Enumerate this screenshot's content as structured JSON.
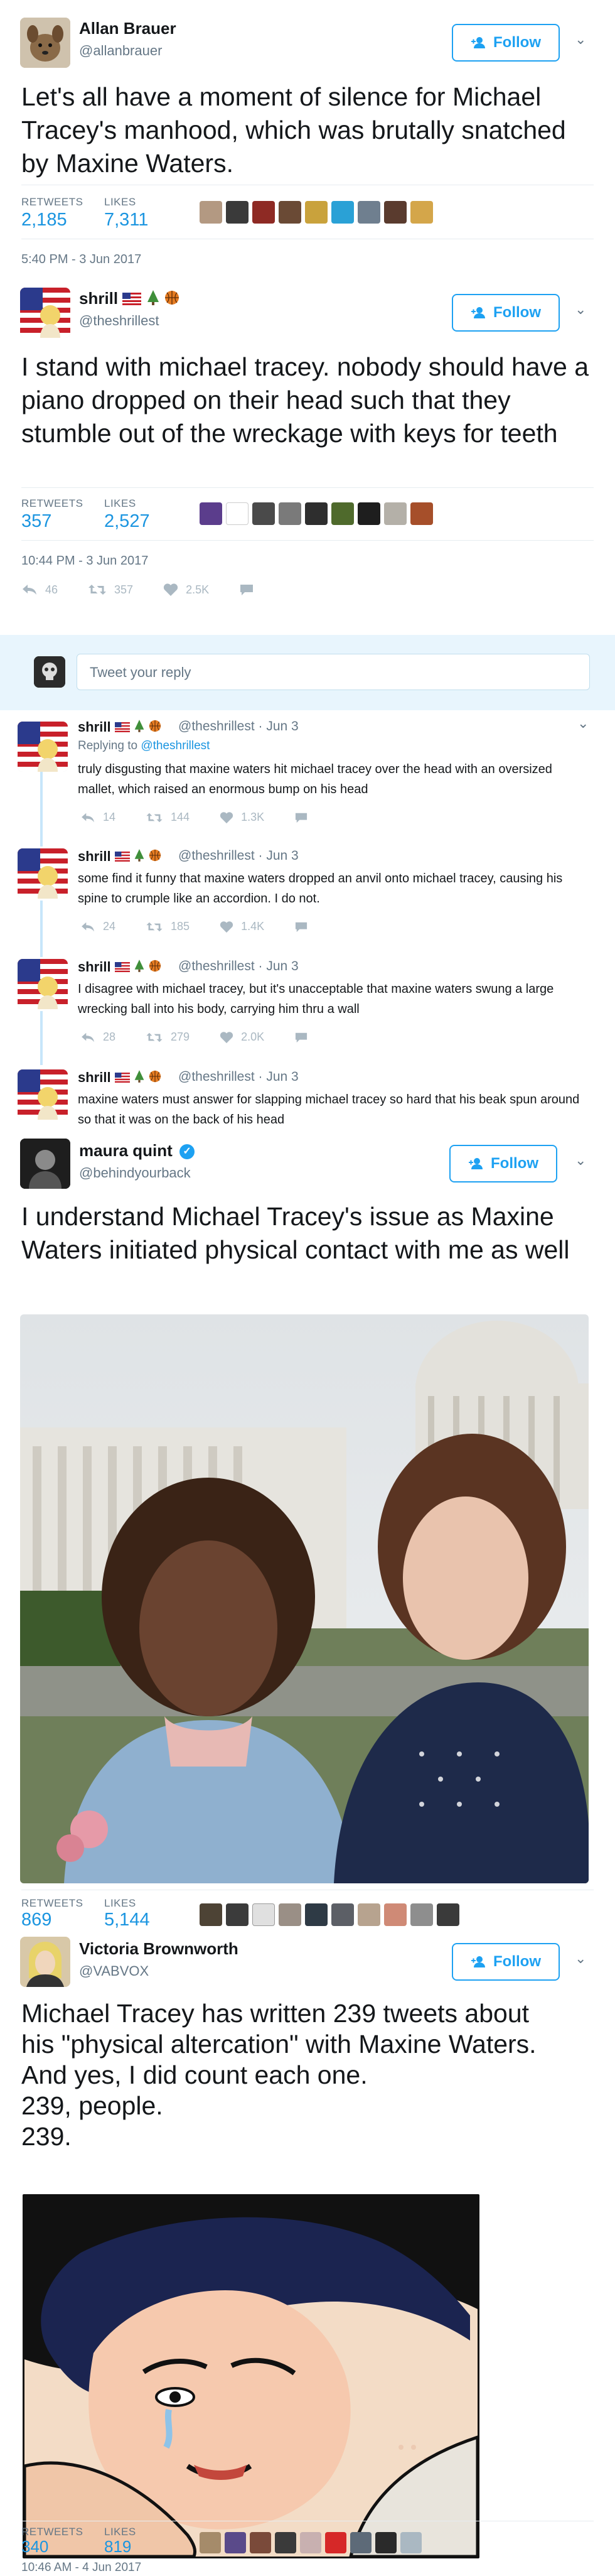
{
  "tweet1": {
    "name": "Allan Brauer",
    "handle": "@allanbrauer",
    "follow_label": "Follow",
    "text": "Let's all have a moment of silence for Michael Tracey's manhood, which was brutally snatched by Maxine Waters.",
    "retweets_label": "RETWEETS",
    "likes_label": "LIKES",
    "retweets": "2,185",
    "likes": "7,311",
    "timestamp": "5:40 PM - 3 Jun 2017"
  },
  "tweet2": {
    "name": "shrill",
    "handle": "@theshrillest",
    "follow_label": "Follow",
    "text": "I stand with michael tracey. nobody should have a piano dropped on their head such that they stumble out of the wreckage with keys for teeth",
    "retweets_label": "RETWEETS",
    "likes_label": "LIKES",
    "retweets": "357",
    "likes": "2,527",
    "timestamp": "10:44 PM - 3 Jun 2017",
    "actions": {
      "replies": "46",
      "retweets": "357",
      "likes": "2.5K"
    }
  },
  "reply_bar": {
    "placeholder": "Tweet your reply"
  },
  "thread": [
    {
      "name": "shrill",
      "handle": "@theshrillest · Jun 3",
      "replying_prefix": "Replying to",
      "replying_to": "@theshrillest",
      "text": "truly disgusting that maxine waters hit michael tracey over the head with an oversized mallet, which raised an enormous bump on his head",
      "replies": "14",
      "retweets": "144",
      "likes": "1.3K"
    },
    {
      "name": "shrill",
      "handle": "@theshrillest · Jun 3",
      "text": "some find it funny that maxine waters dropped an anvil onto michael tracey, causing his spine to crumple like an accordion. I do not.",
      "replies": "24",
      "retweets": "185",
      "likes": "1.4K"
    },
    {
      "name": "shrill",
      "handle": "@theshrillest · Jun 3",
      "text": "I disagree with michael tracey, but it's unacceptable that maxine waters swung a large wrecking ball into his body, carrying him thru a wall",
      "replies": "28",
      "retweets": "279",
      "likes": "2.0K"
    },
    {
      "name": "shrill",
      "handle": "@theshrillest · Jun 3",
      "text": "maxine waters must answer for slapping michael tracey so hard that his beak spun around so that it was on the back of his head"
    }
  ],
  "tweet3": {
    "name": "maura quint",
    "handle": "@behindyourback",
    "follow_label": "Follow",
    "text": "I understand Michael Tracey's issue as Maxine Waters initiated physical contact with me as well",
    "retweets_label": "RETWEETS",
    "likes_label": "LIKES",
    "retweets": "869",
    "likes": "5,144"
  },
  "tweet4": {
    "name": "Victoria Brownworth",
    "handle": "@VABVOX",
    "follow_label": "Follow",
    "text_lines": [
      "Michael Tracey has written 239 tweets about",
      "his \"physical altercation\" with Maxine Waters.",
      "And yes, I did count each one.",
      "239, people.",
      "239."
    ],
    "retweets_label": "RETWEETS",
    "likes_label": "LIKES",
    "retweets": "340",
    "likes": "819",
    "timestamp": "10:46 AM - 4 Jun 2017"
  },
  "colors": {
    "accent": "#1da1f2",
    "link": "#1b95e0",
    "muted": "#657786",
    "reply_bg": "#e8f5fd"
  }
}
